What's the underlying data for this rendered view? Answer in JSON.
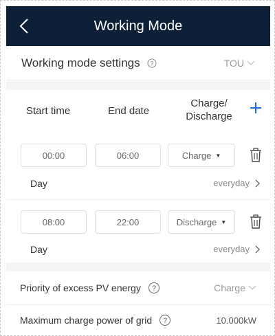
{
  "header": {
    "title": "Working Mode"
  },
  "settings": {
    "label": "Working mode settings",
    "value": "TOU"
  },
  "table": {
    "col_start": "Start time",
    "col_end": "End date",
    "col_charge_line1": "Charge/",
    "col_charge_line2": "Discharge"
  },
  "periods": [
    {
      "start": "00:00",
      "end": "06:00",
      "mode": "Charge",
      "day_label": "Day",
      "day_value": "everyday"
    },
    {
      "start": "08:00",
      "end": "22:00",
      "mode": "Discharge",
      "day_label": "Day",
      "day_value": "everyday"
    }
  ],
  "pv_priority": {
    "label": "Priority of excess PV energy",
    "value": "Charge"
  },
  "grid_power": {
    "label": "Maximum charge power of grid",
    "value": "10.000kW"
  },
  "colors": {
    "header_bg": "#0e2038",
    "accent": "#1a6fe8"
  },
  "icons": [
    "back-arrow-icon",
    "help-icon",
    "chevron-down-icon",
    "plus-icon",
    "trash-icon",
    "chevron-right-icon"
  ]
}
